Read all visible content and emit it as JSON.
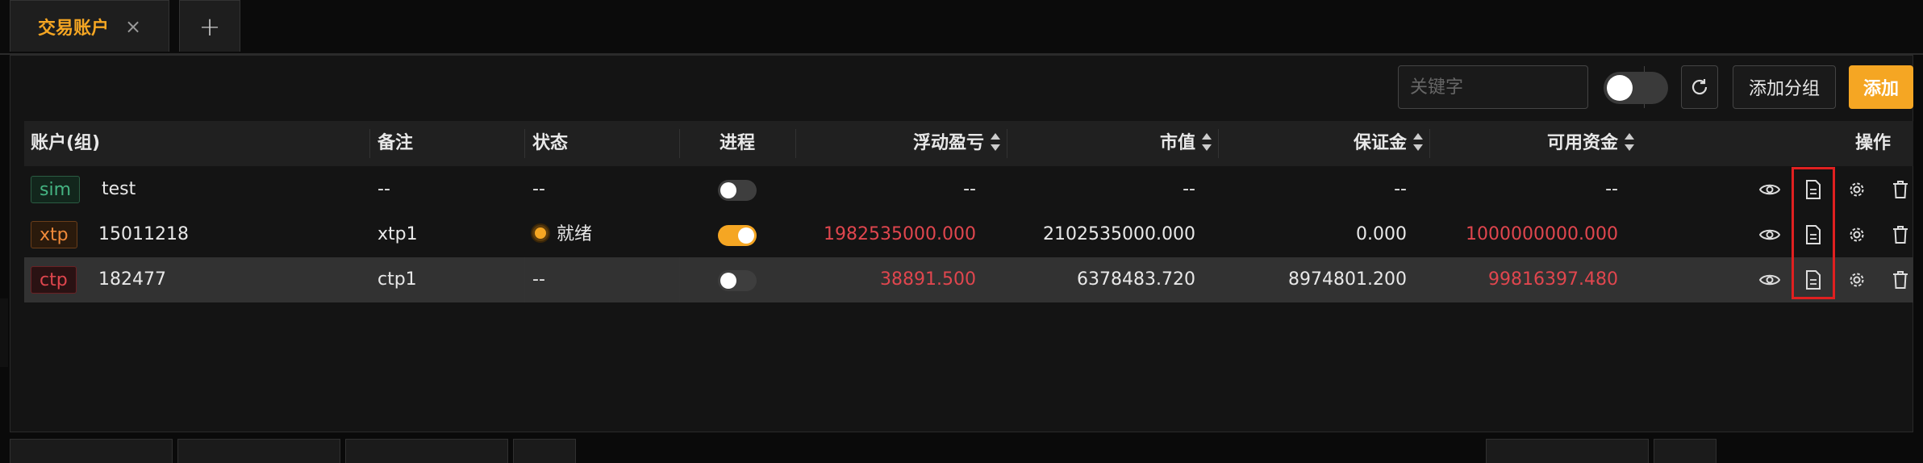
{
  "tabs": [
    {
      "label": "交易账户",
      "active": true
    },
    {
      "label": "+",
      "active": false
    }
  ],
  "toolbar": {
    "search_placeholder": "关键字",
    "add_group_label": "添加分组",
    "add_label": "添加",
    "accent_color": "#f5a623"
  },
  "table": {
    "headers": {
      "account": "账户(组)",
      "remark": "备注",
      "status": "状态",
      "process": "进程",
      "float_pnl": "浮动盈亏",
      "market_value": "市值",
      "margin": "保证金",
      "available": "可用资金",
      "actions": "操作"
    },
    "rows": [
      {
        "tag": "sim",
        "id": "test",
        "remark": "--",
        "status": "--",
        "process_on": false,
        "float_pnl": "--",
        "market_value": "--",
        "margin": "--",
        "available": "--"
      },
      {
        "tag": "xtp",
        "id": "15011218",
        "remark": "xtp1",
        "status": "就绪",
        "process_on": true,
        "float_pnl": "1982535000.000",
        "market_value": "2102535000.000",
        "margin": "0.000",
        "available": "1000000000.000"
      },
      {
        "tag": "ctp",
        "id": "182477",
        "remark": "ctp1",
        "status": "--",
        "process_on": false,
        "float_pnl": "38891.500",
        "market_value": "6378483.720",
        "margin": "8974801.200",
        "available": "99816397.480"
      }
    ],
    "action_icons": [
      "eye-icon",
      "file-icon",
      "gear-icon",
      "trash-icon"
    ]
  },
  "colors": {
    "accent": "#f5a623",
    "negative": "#e0464e",
    "sim": "#45b482",
    "xtp": "#f08a3a",
    "ctp": "#e0464e"
  }
}
